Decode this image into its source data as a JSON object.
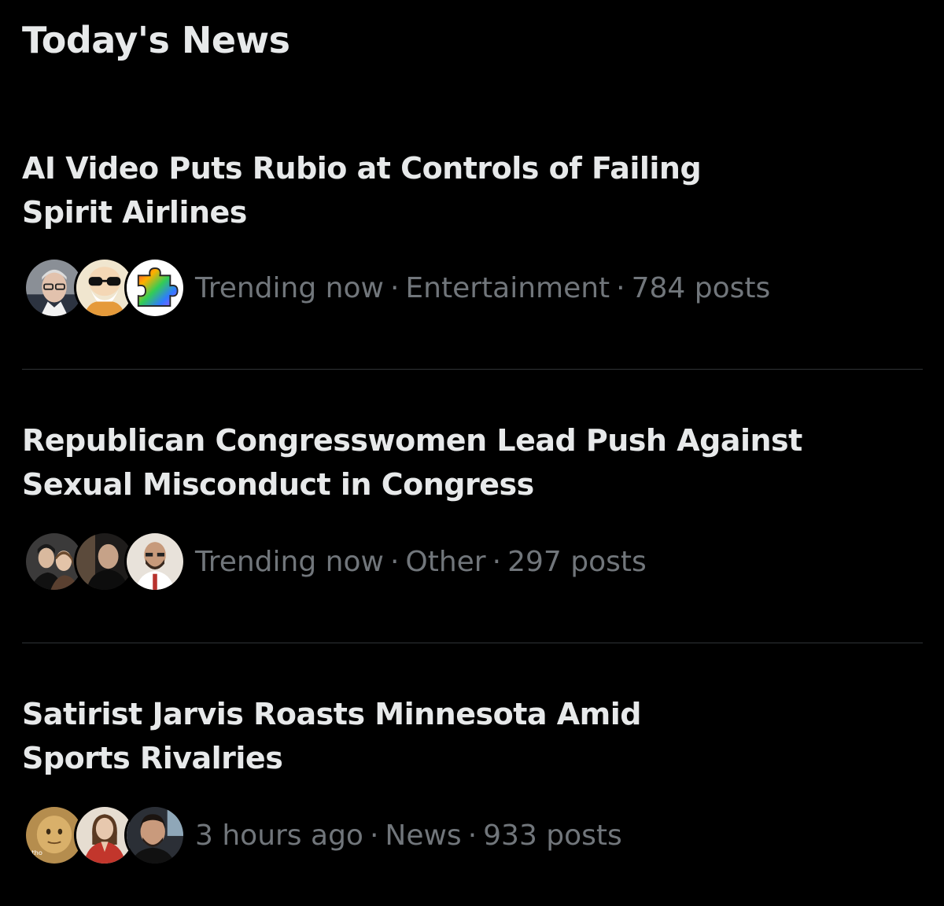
{
  "section": {
    "title": "Today's News"
  },
  "items": [
    {
      "headline_line1": "AI Video Puts Rubio at Controls of Failing",
      "headline_line2": "Spirit Airlines",
      "time": "Trending now",
      "category": "Entertainment",
      "posts": "784 posts",
      "avatars": [
        "man-with-glasses-avatar",
        "cartoon-old-man-sunglasses-avatar",
        "rainbow-puzzle-piece-avatar"
      ]
    },
    {
      "headline_line1": "Republican Congresswomen Lead Push Against",
      "headline_line2": "Sexual Misconduct in Congress",
      "time": "Trending now",
      "category": "Other",
      "posts": "297 posts",
      "avatars": [
        "two-people-selfie-avatar",
        "man-in-dark-room-avatar",
        "bald-man-speaking-avatar"
      ]
    },
    {
      "headline_line1": "Satirist Jarvis Roasts Minnesota Amid",
      "headline_line2": "Sports Rivalries",
      "time": "3 hours ago",
      "category": "News",
      "posts": "933 posts",
      "avatars": [
        "meme-figure-avatar",
        "woman-portrait-avatar",
        "man-in-car-avatar"
      ],
      "avatar_caption": "tho"
    }
  ],
  "separator": "·",
  "colors": {
    "background": "#000000",
    "headline": "#e7e9ea",
    "meta": "#71767b",
    "divider": "#2f3336"
  }
}
